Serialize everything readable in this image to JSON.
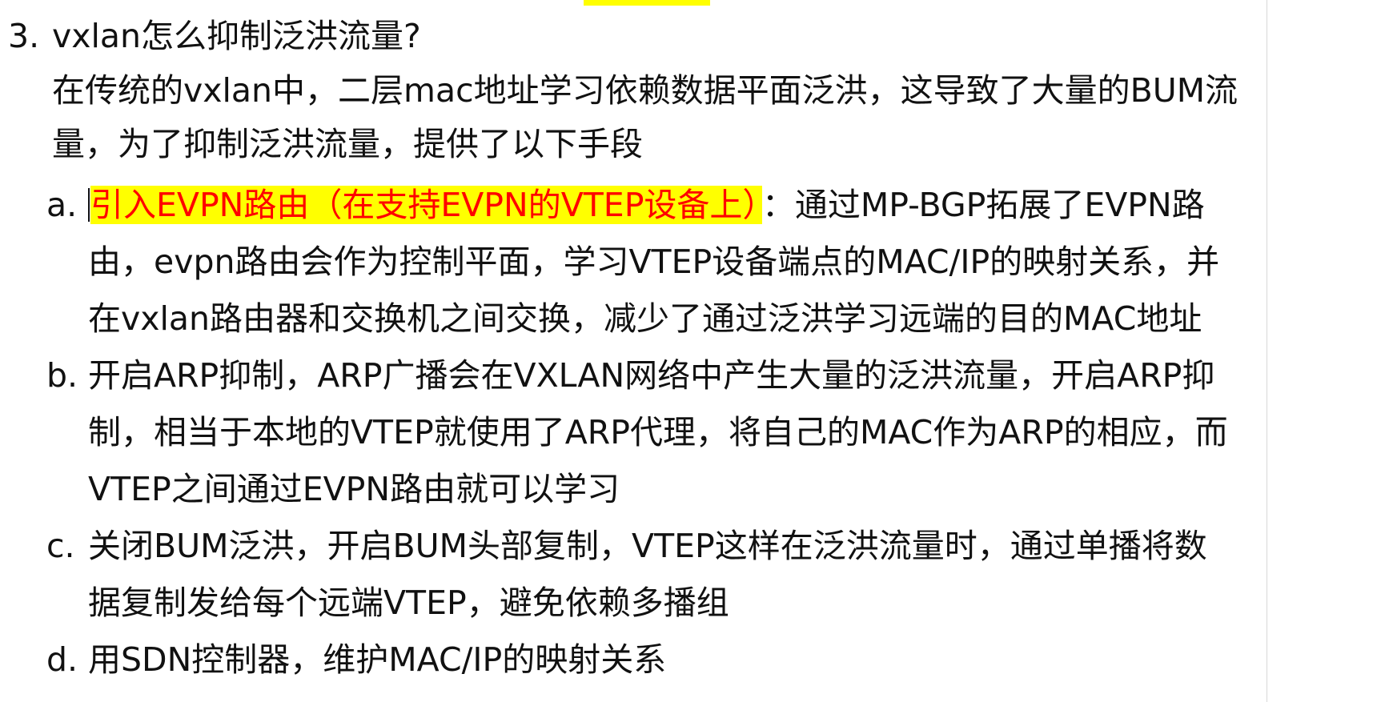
{
  "question": {
    "number": "3.",
    "title": "vxlan怎么抑制泛洪流量?"
  },
  "intro": {
    "line1": "在传统的vxlan中，二层mac地址学习依赖数据平面泛洪，这导致了大量的BUM流",
    "line2": "量，为了抑制泛洪流量，提供了以下手段"
  },
  "items": [
    {
      "marker": "a.",
      "highlight": "引入EVPN路由（在支持EVPN的VTEP设备上）",
      "line1_rest": "：通过MP-BGP拓展了EVPN路",
      "line2": "由，evpn路由会作为控制平面，学习VTEP设备端点的MAC/IP的映射关系，并",
      "line3": "在vxlan路由器和交换机之间交换，减少了通过泛洪学习远端的目的MAC地址"
    },
    {
      "marker": "b.",
      "line1": "开启ARP抑制，ARP广播会在VXLAN网络中产生大量的泛洪流量，开启ARP抑",
      "line2": "制，相当于本地的VTEP就使用了ARP代理，将自己的MAC作为ARP的相应，而",
      "line3": "VTEP之间通过EVPN路由就可以学习"
    },
    {
      "marker": "c.",
      "line1": "关闭BUM泛洪，开启BUM头部复制，VTEP这样在泛洪流量时，通过单播将数",
      "line2": "据复制发给每个远端VTEP，避免依赖多播组"
    },
    {
      "marker": "d.",
      "line1": "用SDN控制器，维护MAC/IP的映射关系"
    }
  ],
  "colors": {
    "highlight_background": "#ffff00",
    "highlight_text": "#ff0000",
    "body_text": "#111111"
  }
}
